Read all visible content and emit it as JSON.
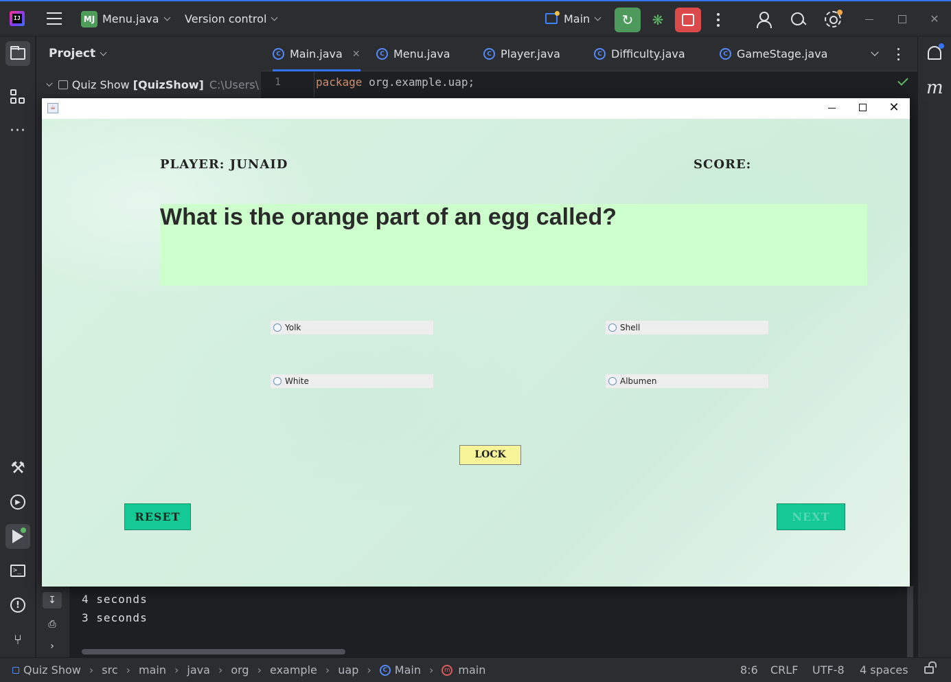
{
  "ide": {
    "project_badge": "MJ",
    "project_file": "Menu.java",
    "vcs_label": "Version control",
    "run_config": "Main",
    "colors": {
      "accent": "#3574f0",
      "run": "#4d9a5c",
      "stop": "#db4a4a"
    }
  },
  "project_panel": {
    "title": "Project",
    "root_name": "Quiz Show",
    "root_module": "[QuizShow]",
    "root_path": "C:\\Users\\"
  },
  "editor": {
    "tabs": [
      {
        "label": "Main.java",
        "active": true
      },
      {
        "label": "Menu.java",
        "active": false
      },
      {
        "label": "Player.java",
        "active": false
      },
      {
        "label": "Difficulty.java",
        "active": false
      },
      {
        "label": "GameStage.java",
        "active": false
      }
    ],
    "line_number": "1",
    "code_keyword": "package",
    "code_rest": " org.example.uap;"
  },
  "run_output": {
    "lines": [
      "4 seconds",
      "3 seconds"
    ]
  },
  "statusbar": {
    "crumbs": [
      "Quiz Show",
      "src",
      "main",
      "java",
      "org",
      "example",
      "uap",
      "Main",
      "main"
    ],
    "position": "8:6",
    "line_sep": "CRLF",
    "encoding": "UTF-8",
    "indent": "4 spaces"
  },
  "quiz": {
    "player_label": "PLAYER: JUNAID",
    "score_label": "SCORE:",
    "question": "What is the orange part of an egg called?",
    "options": [
      "Yolk",
      "Shell",
      "White",
      "Albumen"
    ],
    "lock_label": "LOCK",
    "reset_label": "RESET",
    "next_label": "NEXT",
    "colors": {
      "question_bg": "#ccffcc",
      "lock_bg": "#f8f49a",
      "nav_btn_bg": "#14c994"
    }
  }
}
